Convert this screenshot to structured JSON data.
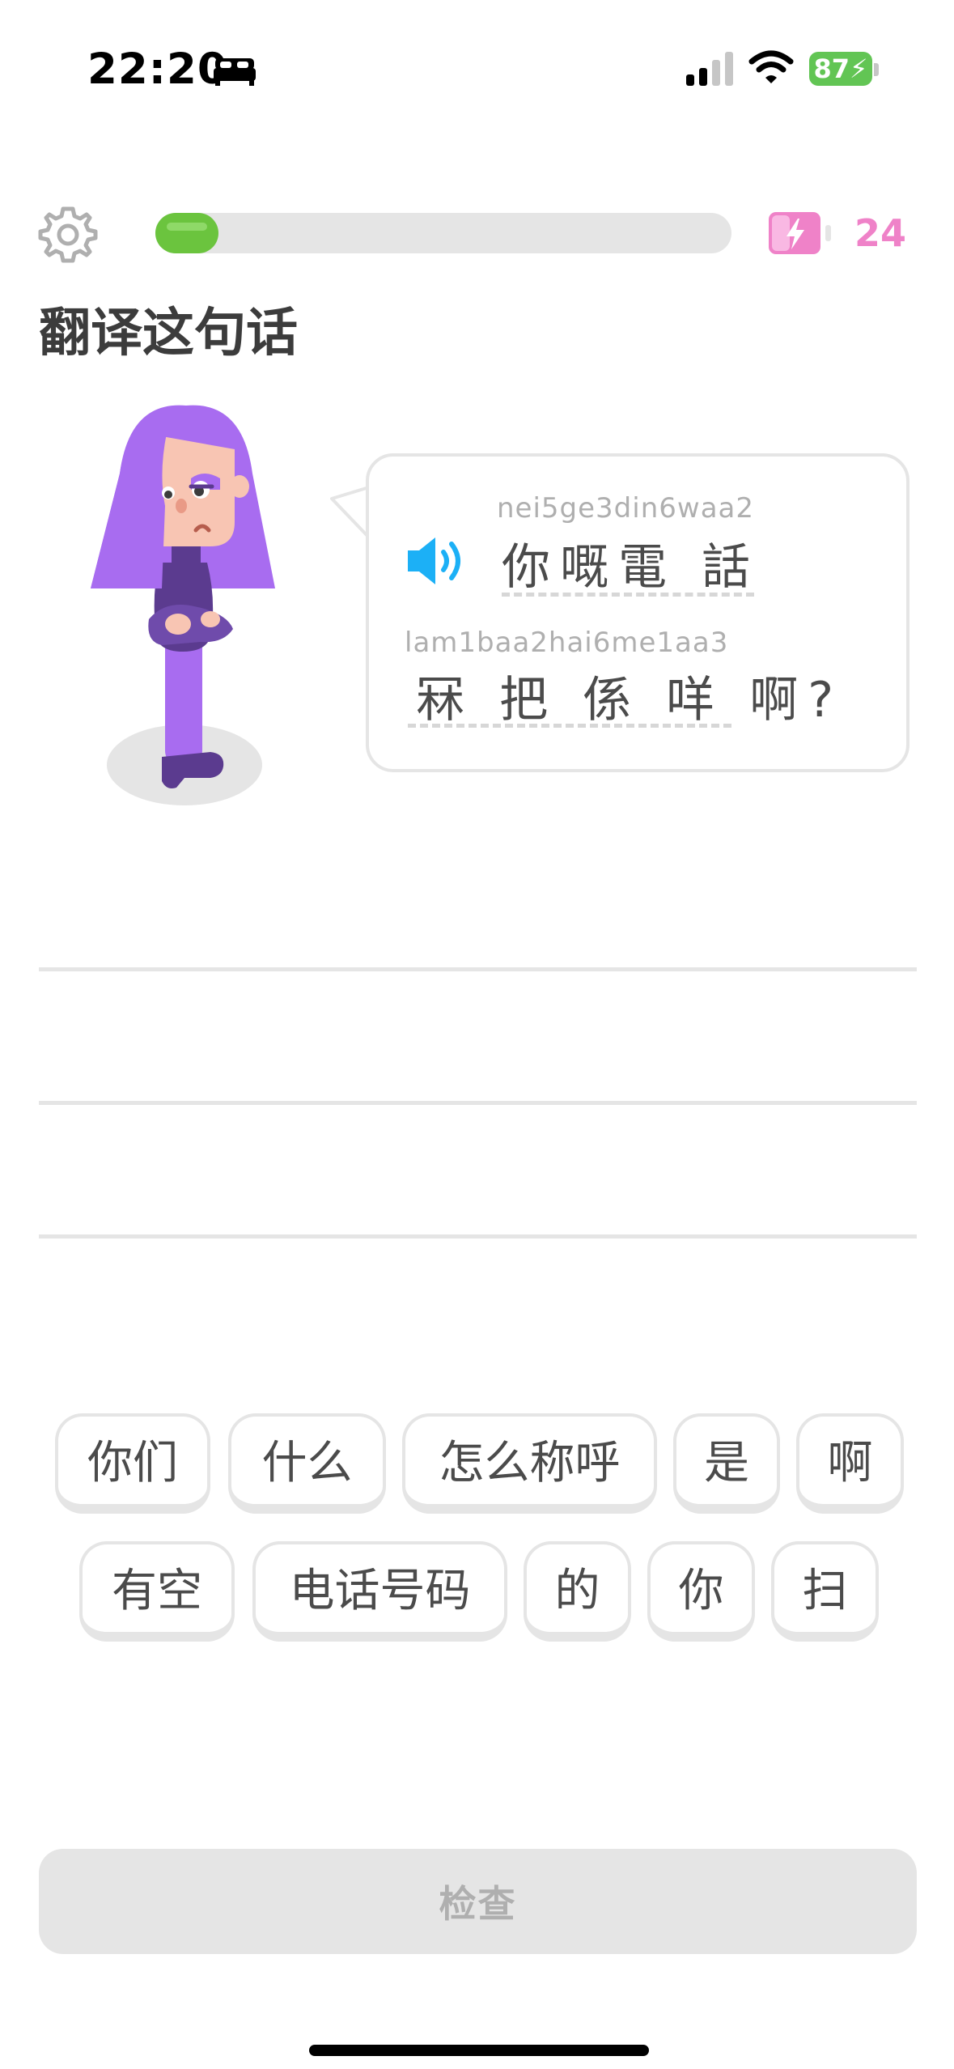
{
  "status_bar": {
    "time": "22:20",
    "battery": "87"
  },
  "header": {
    "progress_fraction": 0.11,
    "energy_count": "24",
    "progress_color": "#6bc43e",
    "energy_color": "#ef82c8"
  },
  "prompt": {
    "title": "翻译这句话"
  },
  "bubble": {
    "line1": {
      "romanization": "nei5ge3din6waa2",
      "text": "你嘅電 話"
    },
    "line2": {
      "romanization": "lam1baa2hai6me1aa3",
      "text": "冧 把 係 咩 啊?"
    }
  },
  "word_bank": {
    "row1": [
      "你们",
      "什么",
      "怎么称呼",
      "是",
      "啊"
    ],
    "row2": [
      "有空",
      "电话号码",
      "的",
      "你",
      "扫"
    ]
  },
  "footer": {
    "check_label": "检查"
  },
  "icons": {
    "settings": "gear-icon",
    "energy": "energy-battery-icon",
    "speaker": "speaker-icon"
  }
}
